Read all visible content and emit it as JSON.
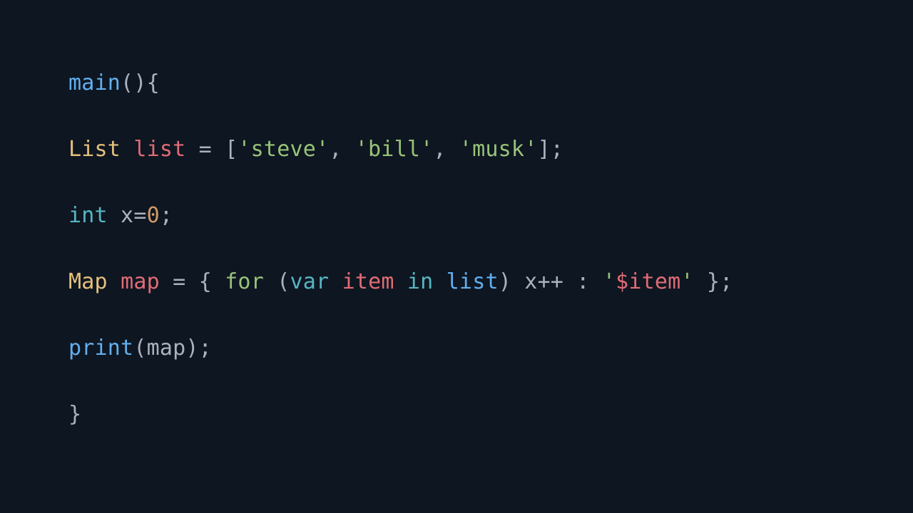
{
  "code": {
    "line1": {
      "main": "main",
      "parens_open": "(",
      "parens_close": ")",
      "brace_open": "{"
    },
    "line2": {
      "type": "List",
      "name": "list",
      "eq": " = [",
      "s1": "'steve'",
      "c1": ", ",
      "s2": "'bill'",
      "c2": ", ",
      "s3": "'musk'",
      "end": "];"
    },
    "line3": {
      "kw": "int",
      "rest": " x=",
      "num": "0",
      "semi": ";"
    },
    "line4": {
      "type": "Map",
      "name": "map",
      "eq": " = { ",
      "for": "for",
      "po": " (",
      "var": "var",
      "sp1": " ",
      "item": "item",
      "sp2": " ",
      "in": "in",
      "sp3": " ",
      "list": "list",
      "pc": ") x++ : ",
      "q1": "'",
      "interp": "$item",
      "q2": "'",
      "end": " };"
    },
    "line5": {
      "print": "print",
      "open": "(",
      "arg": "map",
      "close": ");"
    },
    "line6": {
      "brace_close": "}"
    }
  }
}
